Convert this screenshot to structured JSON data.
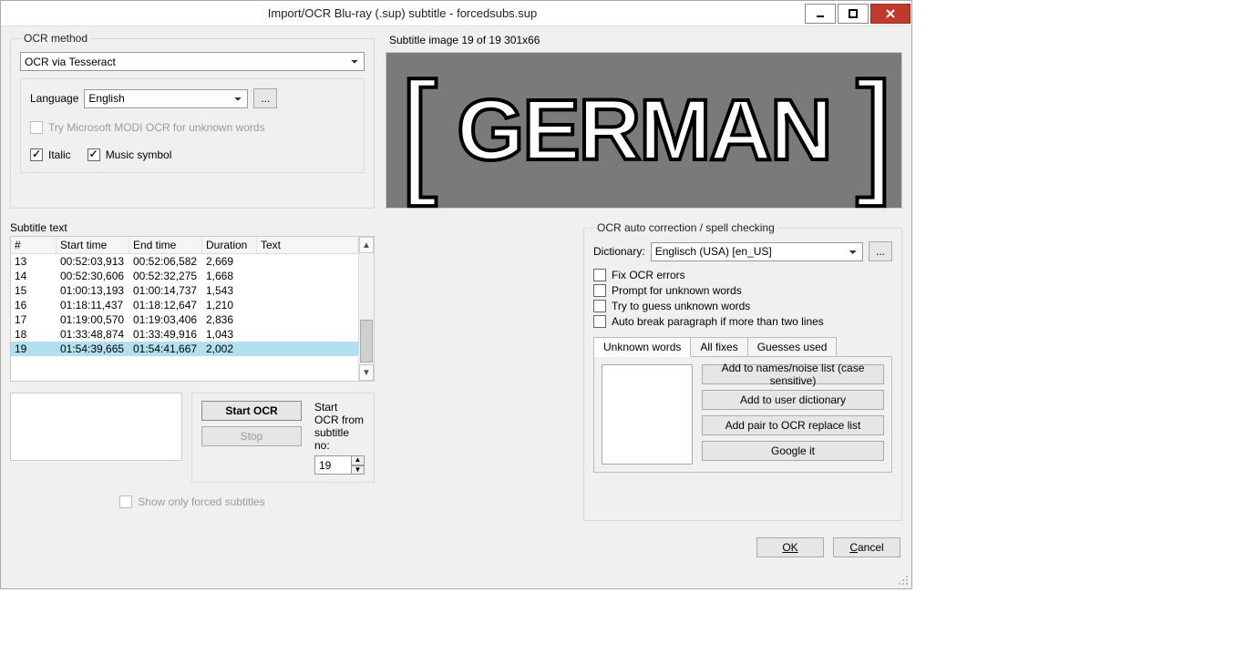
{
  "title": "Import/OCR Blu-ray (.sup) subtitle - forcedsubs.sup",
  "ocr_method": {
    "legend": "OCR method",
    "value": "OCR via Tesseract",
    "language_label": "Language",
    "language_value": "English",
    "browse": "...",
    "try_modi": "Try Microsoft MODI OCR for unknown words",
    "italic": "Italic",
    "music_symbol": "Music symbol"
  },
  "preview": {
    "label": "Subtitle image 19 of 19   301x66",
    "text": "GERMAN"
  },
  "subtitle_text_label": "Subtitle text",
  "columns": {
    "num": "#",
    "start": "Start time",
    "end": "End time",
    "dur": "Duration",
    "text": "Text"
  },
  "rows": [
    {
      "n": "13",
      "start": "00:52:03,913",
      "end": "00:52:06,582",
      "dur": "2,669",
      "text": ""
    },
    {
      "n": "14",
      "start": "00:52:30,606",
      "end": "00:52:32,275",
      "dur": "1,668",
      "text": ""
    },
    {
      "n": "15",
      "start": "01:00:13,193",
      "end": "01:00:14,737",
      "dur": "1,543",
      "text": ""
    },
    {
      "n": "16",
      "start": "01:18:11,437",
      "end": "01:18:12,647",
      "dur": "1,210",
      "text": ""
    },
    {
      "n": "17",
      "start": "01:19:00,570",
      "end": "01:19:03,406",
      "dur": "2,836",
      "text": ""
    },
    {
      "n": "18",
      "start": "01:33:48,874",
      "end": "01:33:49,916",
      "dur": "1,043",
      "text": ""
    },
    {
      "n": "19",
      "start": "01:54:39,665",
      "end": "01:54:41,667",
      "dur": "2,002",
      "text": ""
    }
  ],
  "start_ocr": {
    "start": "Start OCR",
    "stop": "Stop",
    "from_label": "Start OCR from subtitle no:",
    "from_value": "19"
  },
  "forced_only": "Show only forced subtitles",
  "auto": {
    "legend": "OCR auto correction / spell checking",
    "dict_label": "Dictionary:",
    "dict_value": "Englisch (USA) [en_US]",
    "browse": "...",
    "fix_errors": "Fix OCR errors",
    "prompt_unknown": "Prompt for unknown words",
    "guess_unknown": "Try to guess unknown words",
    "auto_break": "Auto break paragraph if more than two lines",
    "tabs": {
      "unknown": "Unknown words",
      "allfixes": "All fixes",
      "guesses": "Guesses used"
    },
    "btn_names": "Add to names/noise list (case sensitive)",
    "btn_userdict": "Add to user dictionary",
    "btn_pair": "Add pair to OCR replace list",
    "btn_google": "Google it"
  },
  "footer": {
    "ok": "OK",
    "cancel": "Cancel"
  }
}
